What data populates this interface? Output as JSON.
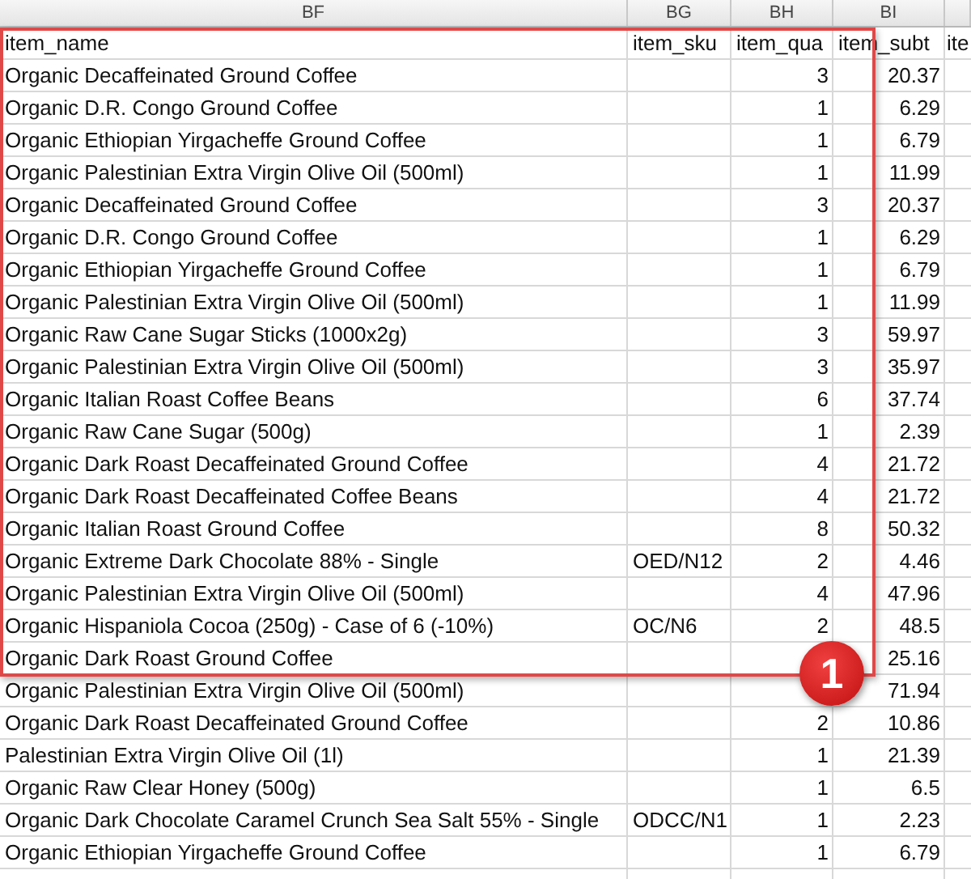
{
  "column_letters": [
    "BF",
    "BG",
    "BH",
    "BI"
  ],
  "header_row": {
    "in_frame": true,
    "cells": [
      "item_name",
      "item_sku",
      "item_qua",
      "item_subt",
      "ite"
    ]
  },
  "rows": [
    {
      "name": "Organic Decaffeinated Ground Coffee",
      "qty": "3",
      "subtotal": "20.37",
      "in_frame": true
    },
    {
      "name": "Organic D.R. Congo Ground Coffee",
      "qty": "1",
      "subtotal": "6.29",
      "in_frame": true
    },
    {
      "name": "Organic Ethiopian Yirgacheffe Ground Coffee",
      "qty": "1",
      "subtotal": "6.79",
      "in_frame": true
    },
    {
      "name": "Organic Palestinian Extra Virgin Olive Oil (500ml)",
      "qty": "1",
      "subtotal": "11.99",
      "in_frame": true
    },
    {
      "name": "Organic Decaffeinated Ground Coffee",
      "qty": "3",
      "subtotal": "20.37",
      "in_frame": true
    },
    {
      "name": "Organic D.R. Congo Ground Coffee",
      "qty": "1",
      "subtotal": "6.29",
      "in_frame": true
    },
    {
      "name": "Organic Ethiopian Yirgacheffe Ground Coffee",
      "qty": "1",
      "subtotal": "6.79",
      "in_frame": true
    },
    {
      "name": "Organic Palestinian Extra Virgin Olive Oil (500ml)",
      "qty": "1",
      "subtotal": "11.99",
      "in_frame": true
    },
    {
      "name": "Organic Raw Cane Sugar Sticks (1000x2g)",
      "qty": "3",
      "subtotal": "59.97",
      "in_frame": true
    },
    {
      "name": "Organic Palestinian Extra Virgin Olive Oil (500ml)",
      "qty": "3",
      "subtotal": "35.97",
      "in_frame": true
    },
    {
      "name": "Organic Italian Roast Coffee Beans",
      "qty": "6",
      "subtotal": "37.74",
      "in_frame": true
    },
    {
      "name": "Organic Raw Cane Sugar (500g)",
      "qty": "1",
      "subtotal": "2.39",
      "in_frame": true
    },
    {
      "name": "Organic Dark Roast Decaffeinated Ground Coffee",
      "qty": "4",
      "subtotal": "21.72",
      "in_frame": true
    },
    {
      "name": "Organic Dark Roast Decaffeinated Coffee Beans",
      "qty": "4",
      "subtotal": "21.72",
      "in_frame": true
    },
    {
      "name": "Organic Italian Roast Ground Coffee",
      "qty": "8",
      "subtotal": "50.32",
      "in_frame": true
    },
    {
      "name": "Organic Extreme Dark Chocolate 88% - Single",
      "sku": "OED/N12",
      "qty": "2",
      "subtotal": "4.46",
      "in_frame": true
    },
    {
      "name": "Organic Palestinian Extra Virgin Olive Oil (500ml)",
      "qty": "4",
      "subtotal": "47.96",
      "in_frame": true
    },
    {
      "name": "Organic Hispaniola Cocoa (250g) - Case of 6 (-10%)",
      "sku": "OC/N6",
      "qty": "2",
      "subtotal": "48.5",
      "in_frame": true
    },
    {
      "name": "Organic Dark Roast Ground Coffee",
      "subtotal": "25.16",
      "in_frame": true
    },
    {
      "name": "Organic Palestinian Extra Virgin Olive Oil (500ml)",
      "subtotal": "71.94",
      "in_frame": false
    },
    {
      "name": "Organic Dark Roast Decaffeinated Ground Coffee",
      "qty": "2",
      "subtotal": "10.86",
      "in_frame": false
    },
    {
      "name": "Palestinian Extra Virgin Olive Oil (1l)",
      "qty": "1",
      "subtotal": "21.39",
      "in_frame": false
    },
    {
      "name": "Organic Raw Clear Honey (500g)",
      "qty": "1",
      "subtotal": "6.5",
      "in_frame": false
    },
    {
      "name": "Organic Dark Chocolate Caramel Crunch Sea Salt 55% - Single",
      "sku": "ODCC/N1",
      "qty": "1",
      "subtotal": "2.23",
      "in_frame": false
    },
    {
      "name": "Organic Ethiopian Yirgacheffe Ground Coffee",
      "qty": "1",
      "subtotal": "6.79",
      "in_frame": false
    }
  ],
  "callout": {
    "label": "1"
  }
}
